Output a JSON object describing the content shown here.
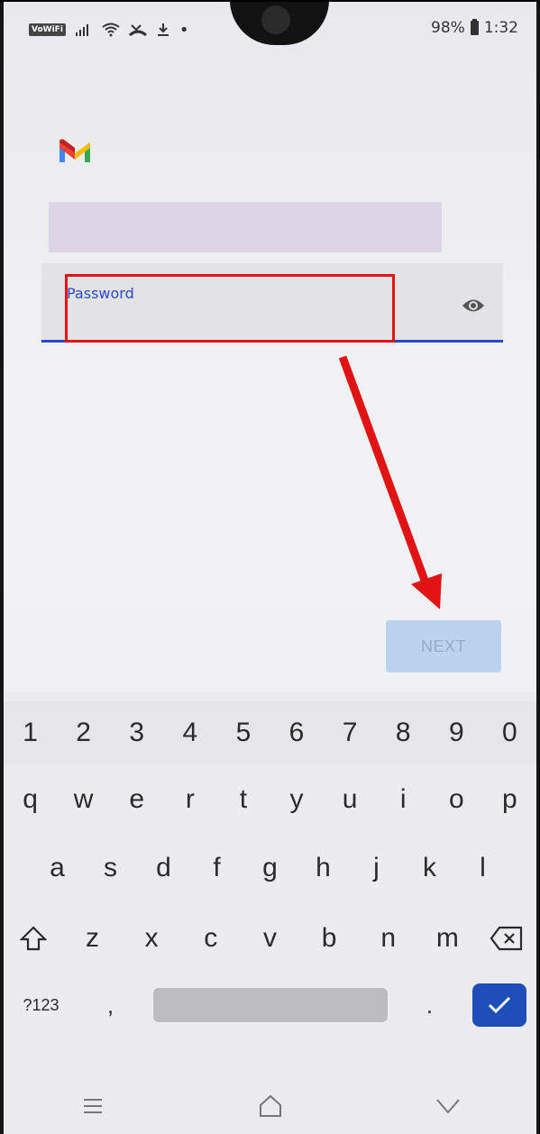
{
  "status_bar": {
    "network_badge": "VoWiFi",
    "battery_percent": "98%",
    "time": "1:32",
    "icons": [
      "signal-icon",
      "wifi-icon",
      "missed-call-icon",
      "download-icon",
      "dot-icon",
      "battery-icon"
    ]
  },
  "app": {
    "logo_icon": "gmail-logo-icon"
  },
  "form": {
    "password_label": "Password",
    "password_value": "",
    "visibility_icon": "eye-icon",
    "next_label": "NEXT"
  },
  "annotation": {
    "highlight_color": "#e01414",
    "arrow_color": "#e01414"
  },
  "keyboard": {
    "number_row": [
      "1",
      "2",
      "3",
      "4",
      "5",
      "6",
      "7",
      "8",
      "9",
      "0"
    ],
    "row1": [
      "q",
      "w",
      "e",
      "r",
      "t",
      "y",
      "u",
      "i",
      "o",
      "p"
    ],
    "row2": [
      "a",
      "s",
      "d",
      "f",
      "g",
      "h",
      "j",
      "k",
      "l"
    ],
    "row3": [
      "z",
      "x",
      "c",
      "v",
      "b",
      "n",
      "m"
    ],
    "symbols_label": "?123",
    "comma_label": ",",
    "period_label": "."
  },
  "colors": {
    "accent": "#2b48c6",
    "next_button_bg": "#bbd3ef",
    "enter_key_bg": "#1e4fb8"
  }
}
